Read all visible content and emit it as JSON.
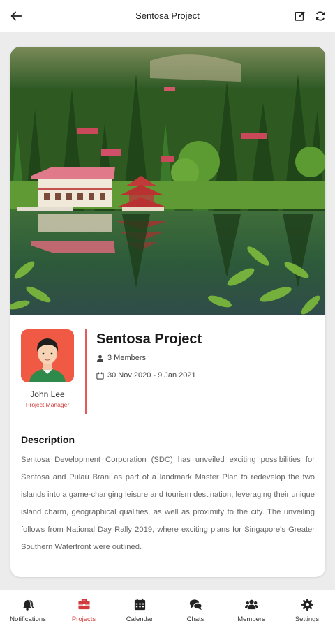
{
  "header": {
    "title": "Sentosa Project",
    "back_icon": "arrow-left-icon",
    "edit_icon": "edit-icon",
    "refresh_icon": "refresh-icon"
  },
  "project": {
    "hero_image": "lake-pagoda-photo",
    "title": "Sentosa Project",
    "members": "3 Members",
    "dates": "30 Nov 2020 - 9 Jan 2021",
    "manager": {
      "name": "John Lee",
      "role": "Project Manager"
    }
  },
  "description": {
    "heading": "Description",
    "text": "Sentosa Development Corporation (SDC) has unveiled exciting possibilities for Sentosa and Pulau Brani as part of a landmark Master Plan to redevelop the two islands into a game-changing leisure and tourism destination, leveraging their unique island charm, geographical qualities, as well as proximity to the city. The unveiling follows from National Day Rally 2019, where exciting plans for Singapore's Greater Southern Waterfront were outlined."
  },
  "nav": {
    "items": [
      {
        "label": "Notifications",
        "icon": "bell-icon"
      },
      {
        "label": "Projects",
        "icon": "briefcase-icon",
        "active": true
      },
      {
        "label": "Calendar",
        "icon": "calendar-icon"
      },
      {
        "label": "Chats",
        "icon": "chat-icon"
      },
      {
        "label": "Members",
        "icon": "members-icon"
      },
      {
        "label": "Settings",
        "icon": "gear-icon"
      }
    ]
  },
  "colors": {
    "accent": "#d23c3c",
    "avatar_bg": "#f05a45"
  }
}
